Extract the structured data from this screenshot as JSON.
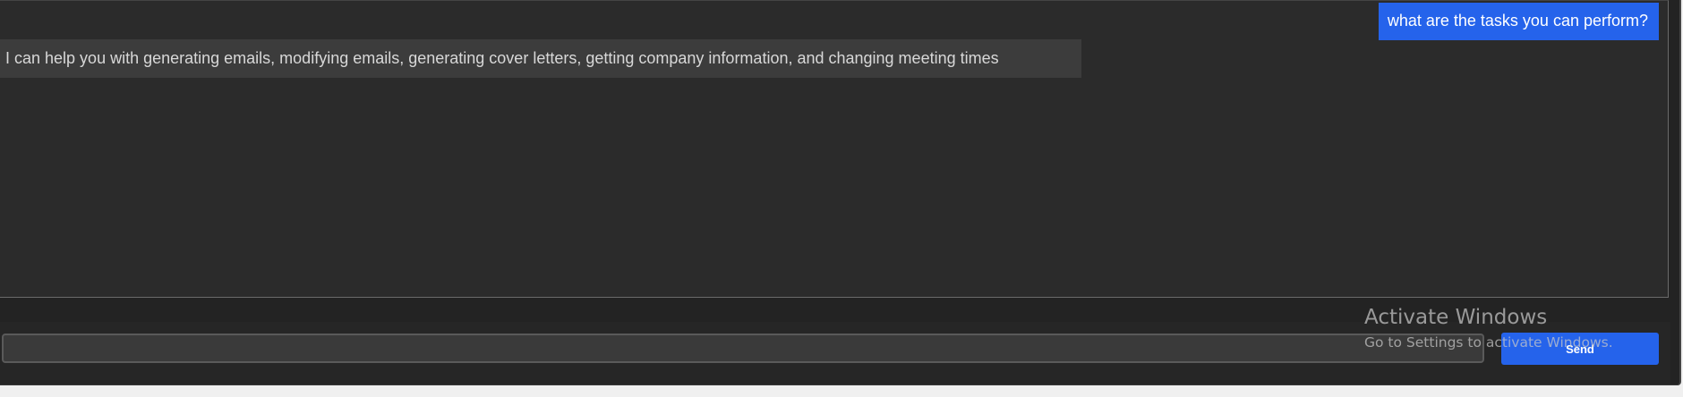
{
  "chat": {
    "messages": [
      {
        "role": "user",
        "text": "what are the tasks you can perform?"
      },
      {
        "role": "assistant",
        "text": "I can help you with generating emails, modifying emails, generating cover letters, getting company information, and changing meeting times"
      }
    ]
  },
  "composer": {
    "input_value": "",
    "placeholder": "",
    "send_label": "Send"
  },
  "watermark": {
    "title": "Activate Windows",
    "subtitle": "Go to Settings to activate Windows."
  },
  "colors": {
    "accent": "#2563eb",
    "background": "#2b2b2b",
    "bot_bubble": "#3c3c3c"
  }
}
